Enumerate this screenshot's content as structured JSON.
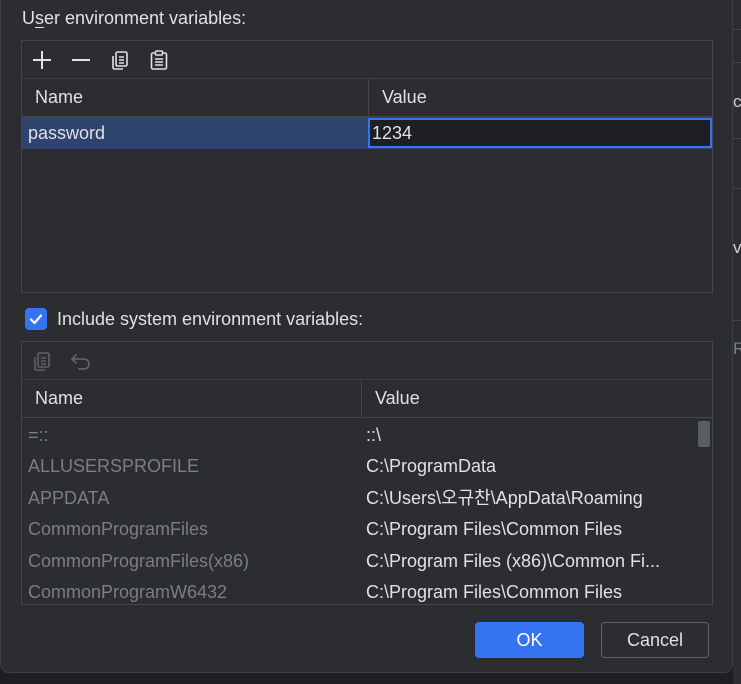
{
  "user_env": {
    "label_prefix": "U",
    "label_mnemonic": "s",
    "label_rest": "er environment variables:",
    "toolbar": [
      "add-icon",
      "remove-icon",
      "copy-icon",
      "paste-icon"
    ],
    "columns": {
      "name": "Name",
      "value": "Value"
    },
    "rows": [
      {
        "name": "password",
        "value": "1234"
      }
    ]
  },
  "include_system": {
    "checked": true,
    "label": "Include system environment variables:"
  },
  "system_env": {
    "toolbar": [
      "copy-icon",
      "undo-icon"
    ],
    "columns": {
      "name": "Name",
      "value": "Value"
    },
    "rows": [
      {
        "name": "=::",
        "value": "::\\"
      },
      {
        "name": "ALLUSERSPROFILE",
        "value": "C:\\ProgramData"
      },
      {
        "name": "APPDATA",
        "value": "C:\\Users\\오규찬\\AppData\\Roaming"
      },
      {
        "name": "CommonProgramFiles",
        "value": "C:\\Program Files\\Common Files"
      },
      {
        "name": "CommonProgramFiles(x86)",
        "value": "C:\\Program Files (x86)\\Common Fi..."
      },
      {
        "name": "CommonProgramW6432",
        "value": "C:\\Program Files\\Common Files"
      }
    ]
  },
  "buttons": {
    "ok": "OK",
    "cancel": "Cancel"
  },
  "background_fragments": [
    "ca",
    "v",
    "R"
  ],
  "colors": {
    "accent": "#3574f0",
    "selection": "#2e436e",
    "panel": "#2b2d30",
    "dim_text": "#7a7e85"
  }
}
